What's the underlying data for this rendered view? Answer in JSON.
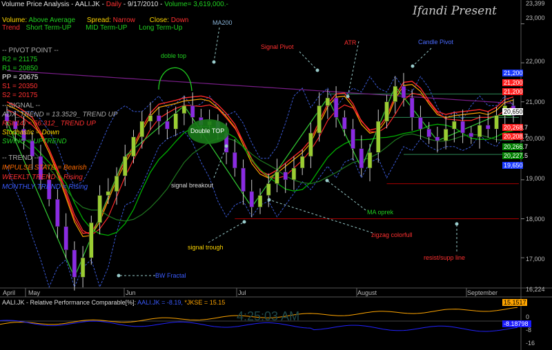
{
  "header": {
    "title": "Volume Price Analysis - AALI.JK - ",
    "period": "Daily",
    "date": " - 9/17/2010 - ",
    "volume": "Volume= 3,619,000.-",
    "watermark": "Ifandi Present"
  },
  "legend": {
    "volume_label": "Volume:",
    "volume_val": "Above Average",
    "spread_label": "Spread:",
    "spread_val": "Narrow",
    "close_label": "Close:",
    "close_val": "Down",
    "trend_label": "Trend",
    "short_term": "Short Term-UP",
    "mid_term": "MID Term-UP",
    "long_term": "Long Term-Up"
  },
  "pivot": {
    "header": "-- PIVOT POINT --",
    "r2": "R2 = 21175",
    "r1": "R1 = 20850",
    "pp": "PP = 20675",
    "s1": "S1 = 20350",
    "s2": "S2 = 20175"
  },
  "signal": {
    "header": "-- SIGNAL --",
    "adx": "ADX_TREND = 13.3529_ TREND UP",
    "rsi": "RSI(14) = 56.312_ TREND UP",
    "stoch": "Stochastic = Down",
    "swing": "SWING = UPTREND"
  },
  "trend": {
    "header": "-- TREND --",
    "impulse": "IMPULSE STATE = Bearish",
    "weekly": "WEEKLT TREND = Rising",
    "monthly": "MONTHLY TREND = Rising"
  },
  "annotations": {
    "ma200": "MA200",
    "double_top_arc": "doble top",
    "double_top": "Double TOP",
    "signal_pivot": "Signal Pivot",
    "atr": "ATR",
    "candle_pivot": "Candle Pivot",
    "signal_breakout": "signal breakout",
    "signal_trough": "signal trough",
    "bw_fractal": "BW Fractal",
    "ma_oprek": "MA oprek",
    "zigzag": "zigzag colorfull",
    "resist": "resist/supp line"
  },
  "price_axis": {
    "ticks": [
      "23,399",
      "23,000",
      "22,000",
      "21,000",
      "20,000",
      "19,000",
      "18,000",
      "17,000",
      "16,224"
    ],
    "boxes": [
      "21,200",
      "21,200",
      "21,200",
      "20,650",
      "20,268.7",
      "20,208.7",
      "20,266.7",
      "20,227.5",
      "19,650"
    ]
  },
  "time_axis": {
    "labels": [
      "April",
      "May",
      "Jun",
      "Jul",
      "August",
      "September"
    ]
  },
  "lower_panel": {
    "title": "AALI.JK - Relative Performance Comparable[%]:",
    "aali": "AALI.JK = -8.19,",
    "jkse": "*JKSE = 15.15",
    "clock": "4:25:03 AM",
    "ticks": [
      "0",
      "-8",
      "-16"
    ],
    "box_jkse": "15.1517",
    "box_aali": "-8.18798"
  },
  "colors": {
    "bull_candle": "#9acd32",
    "bear_candle": "#8a2be2",
    "ema_red": "#ff2a2a",
    "ema_orange": "#ffa500",
    "ma_green": "#00b000",
    "ma200": "#7a1e8a",
    "zigzag": "#32cd32",
    "bands": "#3a5bd9",
    "jkse": "#ffa500",
    "aali": "#2222ff"
  },
  "chart_data": {
    "type": "candlestick",
    "title": "Volume Price Analysis - AALI.JK - Daily - 9/17/2010",
    "ylim": [
      16224,
      23399
    ],
    "x_labels": [
      "April",
      "May",
      "Jun",
      "Jul",
      "August",
      "September"
    ],
    "pivot_lines": {
      "resistance": 21200,
      "support": 19650,
      "trough_line": 18000,
      "aug_low": 18900
    },
    "series_close_approx": [
      20500,
      20300,
      20000,
      19600,
      19000,
      18500,
      17800,
      17200,
      16500,
      17000,
      17900,
      18600,
      18700,
      19100,
      19600,
      20100,
      20500,
      20650,
      20500,
      20300,
      20700,
      20900,
      20600,
      20400,
      20500,
      20200,
      19700,
      19300,
      18700,
      18300,
      18600,
      18900,
      19200,
      19000,
      19300,
      19600,
      20200,
      20900,
      21100,
      20600,
      20300,
      19800,
      19300,
      19700,
      20500,
      21000,
      21400,
      21100,
      20600,
      20300,
      20100,
      20000,
      20300,
      20500,
      20200,
      20100,
      20400,
      20300,
      20650,
      20900,
      20650
    ]
  }
}
